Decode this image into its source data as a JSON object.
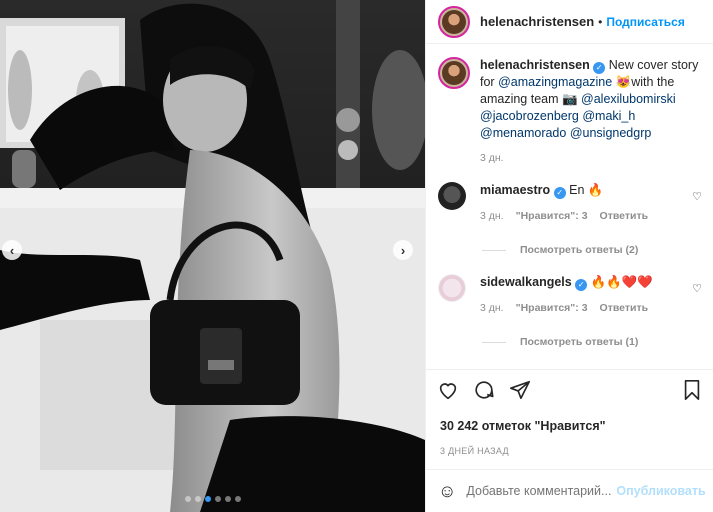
{
  "header": {
    "username": "helenachristensen",
    "separator": "•",
    "follow_label": "Подписаться",
    "more_label": "···"
  },
  "caption": {
    "username": "helenachristensen",
    "text_1": " New cover story for ",
    "mention_1": "@amazingmagazine",
    "text_2": " 😻with the amazing team 📷 ",
    "mention_2": "@alexilubomirski",
    "mention_3": "@jacobrozenberg",
    "mention_4": "@maki_h",
    "mention_5": "@menamorado",
    "mention_6": "@unsignedgrp",
    "time": "3 дн."
  },
  "comments": [
    {
      "username": "miamaestro",
      "text": "En 🔥",
      "time": "3 дн.",
      "likes": "\"Нравится\": 3",
      "reply_label": "Ответить",
      "view_replies": "Посмотреть ответы (2)"
    },
    {
      "username": "sidewalkangels",
      "text": "🔥🔥❤️❤️",
      "time": "3 дн.",
      "likes": "\"Нравится\": 3",
      "reply_label": "Ответить",
      "view_replies": "Посмотреть ответы (1)"
    }
  ],
  "likes_count": "30 242 отметок \"Нравится\"",
  "posted_ago": "3 ДНЕЙ НАЗАД",
  "add_comment": {
    "placeholder": "Добавьте комментарий...",
    "post_label": "Опубликовать"
  },
  "carousel": {
    "slide_count": 6,
    "active_index": 2
  },
  "colors": {
    "accent": "#0095f6",
    "verified": "#3897f0",
    "link": "#00376b",
    "muted": "#8e8e8e"
  }
}
